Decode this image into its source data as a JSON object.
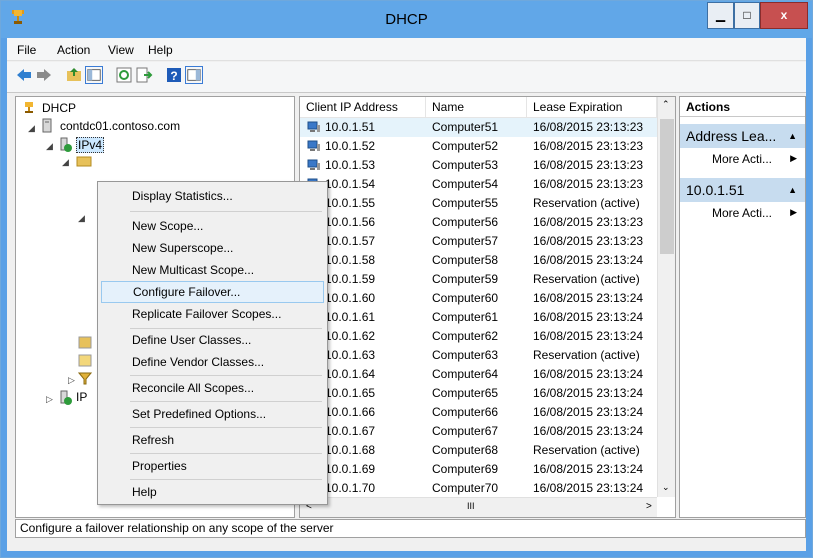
{
  "window": {
    "title": "DHCP",
    "minimize_label": "▁",
    "maximize_label": "□",
    "close_label": "x"
  },
  "menu": [
    "File",
    "Action",
    "View",
    "Help"
  ],
  "toolbar_icons": [
    "back-icon",
    "forward-icon",
    "up-folder-icon",
    "show-hide-tree-icon",
    "refresh-icon",
    "export-list-icon",
    "help-icon",
    "show-hide-action-pane-icon"
  ],
  "tree": {
    "root": "DHCP",
    "server": "contdc01.contoso.com",
    "ipv4": "IPv4",
    "ipv6": "IP"
  },
  "list": {
    "columns": [
      "Client IP Address",
      "Name",
      "Lease Expiration"
    ],
    "rows": [
      [
        "10.0.1.51",
        "Computer51",
        "16/08/2015 23:13:23"
      ],
      [
        "10.0.1.52",
        "Computer52",
        "16/08/2015 23:13:23"
      ],
      [
        "10.0.1.53",
        "Computer53",
        "16/08/2015 23:13:23"
      ],
      [
        "10.0.1.54",
        "Computer54",
        "16/08/2015 23:13:23"
      ],
      [
        "10.0.1.55",
        "Computer55",
        "Reservation (active)"
      ],
      [
        "10.0.1.56",
        "Computer56",
        "16/08/2015 23:13:23"
      ],
      [
        "10.0.1.57",
        "Computer57",
        "16/08/2015 23:13:23"
      ],
      [
        "10.0.1.58",
        "Computer58",
        "16/08/2015 23:13:24"
      ],
      [
        "10.0.1.59",
        "Computer59",
        "Reservation (active)"
      ],
      [
        "10.0.1.60",
        "Computer60",
        "16/08/2015 23:13:24"
      ],
      [
        "10.0.1.61",
        "Computer61",
        "16/08/2015 23:13:24"
      ],
      [
        "10.0.1.62",
        "Computer62",
        "16/08/2015 23:13:24"
      ],
      [
        "10.0.1.63",
        "Computer63",
        "Reservation (active)"
      ],
      [
        "10.0.1.64",
        "Computer64",
        "16/08/2015 23:13:24"
      ],
      [
        "10.0.1.65",
        "Computer65",
        "16/08/2015 23:13:24"
      ],
      [
        "10.0.1.66",
        "Computer66",
        "16/08/2015 23:13:24"
      ],
      [
        "10.0.1.67",
        "Computer67",
        "16/08/2015 23:13:24"
      ],
      [
        "10.0.1.68",
        "Computer68",
        "Reservation (active)"
      ],
      [
        "10.0.1.69",
        "Computer69",
        "16/08/2015 23:13:24"
      ],
      [
        "10.0.1.70",
        "Computer70",
        "16/08/2015 23:13:24"
      ]
    ],
    "hscroll_thumb": "III"
  },
  "actions": {
    "title": "Actions",
    "sections": [
      {
        "label": "Address Lea...",
        "link": "More Acti..."
      },
      {
        "label": "10.0.1.51",
        "link": "More Acti..."
      }
    ]
  },
  "context_menu": {
    "items": [
      "Display Statistics...",
      "New Scope...",
      "New Superscope...",
      "New Multicast Scope...",
      "Configure Failover...",
      "Replicate Failover Scopes...",
      "Define User Classes...",
      "Define Vendor Classes...",
      "Reconcile All Scopes...",
      "Set Predefined Options...",
      "Refresh",
      "Properties",
      "Help"
    ],
    "highlighted": "Configure Failover..."
  },
  "status": "Configure a failover relationship on any scope of the server",
  "colors": {
    "titlebar": "#61a7e8",
    "selection": "#e5f3fb",
    "action_section": "#c7dcef",
    "close_button": "#c75050"
  }
}
